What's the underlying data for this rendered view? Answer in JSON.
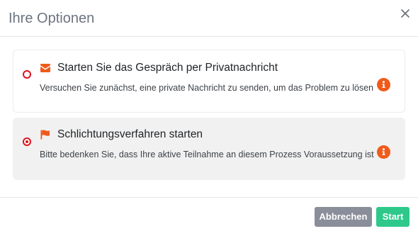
{
  "dialog": {
    "title": "Ihre Optionen",
    "close_icon": "close-icon"
  },
  "options": [
    {
      "title": "Starten Sie das Gespräch per Privatnachricht",
      "description": "Versuchen Sie zunächst, eine private Nachricht zu senden, um das Problem zu lösen",
      "icon": "envelope-icon",
      "selected": false
    },
    {
      "title": "Schlichtungsverfahren starten",
      "description": "Bitte bedenken Sie, dass Ihre aktive Teilnahme an diesem Prozess Voraussetzung ist",
      "icon": "flag-icon",
      "selected": true
    }
  ],
  "footer": {
    "cancel_label": "Abbrechen",
    "start_label": "Start"
  },
  "colors": {
    "accent_orange": "#f05a1a",
    "radio_red": "#e0121e",
    "cancel_gray": "#8a8d9a",
    "start_green": "#2ec98a"
  }
}
